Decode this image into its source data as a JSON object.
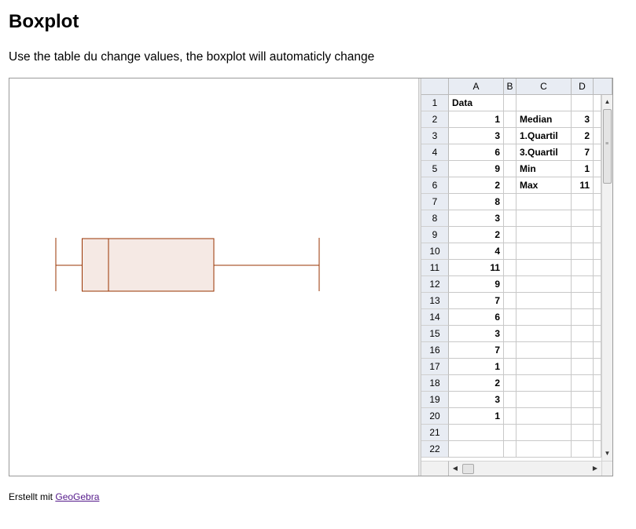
{
  "page": {
    "title": "Boxplot",
    "subtitle": "Use the table du change values, the boxplot will automaticly change"
  },
  "boxplot": {
    "min": 1,
    "q1": 2,
    "median": 3,
    "q3": 7,
    "max": 11,
    "stroke_color": "#993300",
    "fill_color": "#f5e9e4"
  },
  "spreadsheet": {
    "columns": [
      "A",
      "B",
      "C",
      "D"
    ],
    "rows": [
      {
        "n": "1",
        "a": "Data",
        "c": "",
        "d": ""
      },
      {
        "n": "2",
        "a": "1",
        "c": "Median",
        "d": "3"
      },
      {
        "n": "3",
        "a": "3",
        "c": "1.Quartil",
        "d": "2"
      },
      {
        "n": "4",
        "a": "6",
        "c": "3.Quartil",
        "d": "7"
      },
      {
        "n": "5",
        "a": "9",
        "c": "Min",
        "d": "1"
      },
      {
        "n": "6",
        "a": "2",
        "c": "Max",
        "d": "11"
      },
      {
        "n": "7",
        "a": "8",
        "c": "",
        "d": ""
      },
      {
        "n": "8",
        "a": "3",
        "c": "",
        "d": ""
      },
      {
        "n": "9",
        "a": "2",
        "c": "",
        "d": ""
      },
      {
        "n": "10",
        "a": "4",
        "c": "",
        "d": ""
      },
      {
        "n": "11",
        "a": "11",
        "c": "",
        "d": ""
      },
      {
        "n": "12",
        "a": "9",
        "c": "",
        "d": ""
      },
      {
        "n": "13",
        "a": "7",
        "c": "",
        "d": ""
      },
      {
        "n": "14",
        "a": "6",
        "c": "",
        "d": ""
      },
      {
        "n": "15",
        "a": "3",
        "c": "",
        "d": ""
      },
      {
        "n": "16",
        "a": "7",
        "c": "",
        "d": ""
      },
      {
        "n": "17",
        "a": "1",
        "c": "",
        "d": ""
      },
      {
        "n": "18",
        "a": "2",
        "c": "",
        "d": ""
      },
      {
        "n": "19",
        "a": "3",
        "c": "",
        "d": ""
      },
      {
        "n": "20",
        "a": "1",
        "c": "",
        "d": ""
      },
      {
        "n": "21",
        "a": "",
        "c": "",
        "d": ""
      },
      {
        "n": "22",
        "a": "",
        "c": "",
        "d": ""
      }
    ]
  },
  "footer": {
    "prefix": "Erstellt mit",
    "link_text": "GeoGebra"
  },
  "icons": {
    "scroll_up": "arrow-up-icon",
    "scroll_down": "arrow-down-icon",
    "scroll_left": "arrow-left-icon",
    "scroll_right": "arrow-right-icon"
  }
}
